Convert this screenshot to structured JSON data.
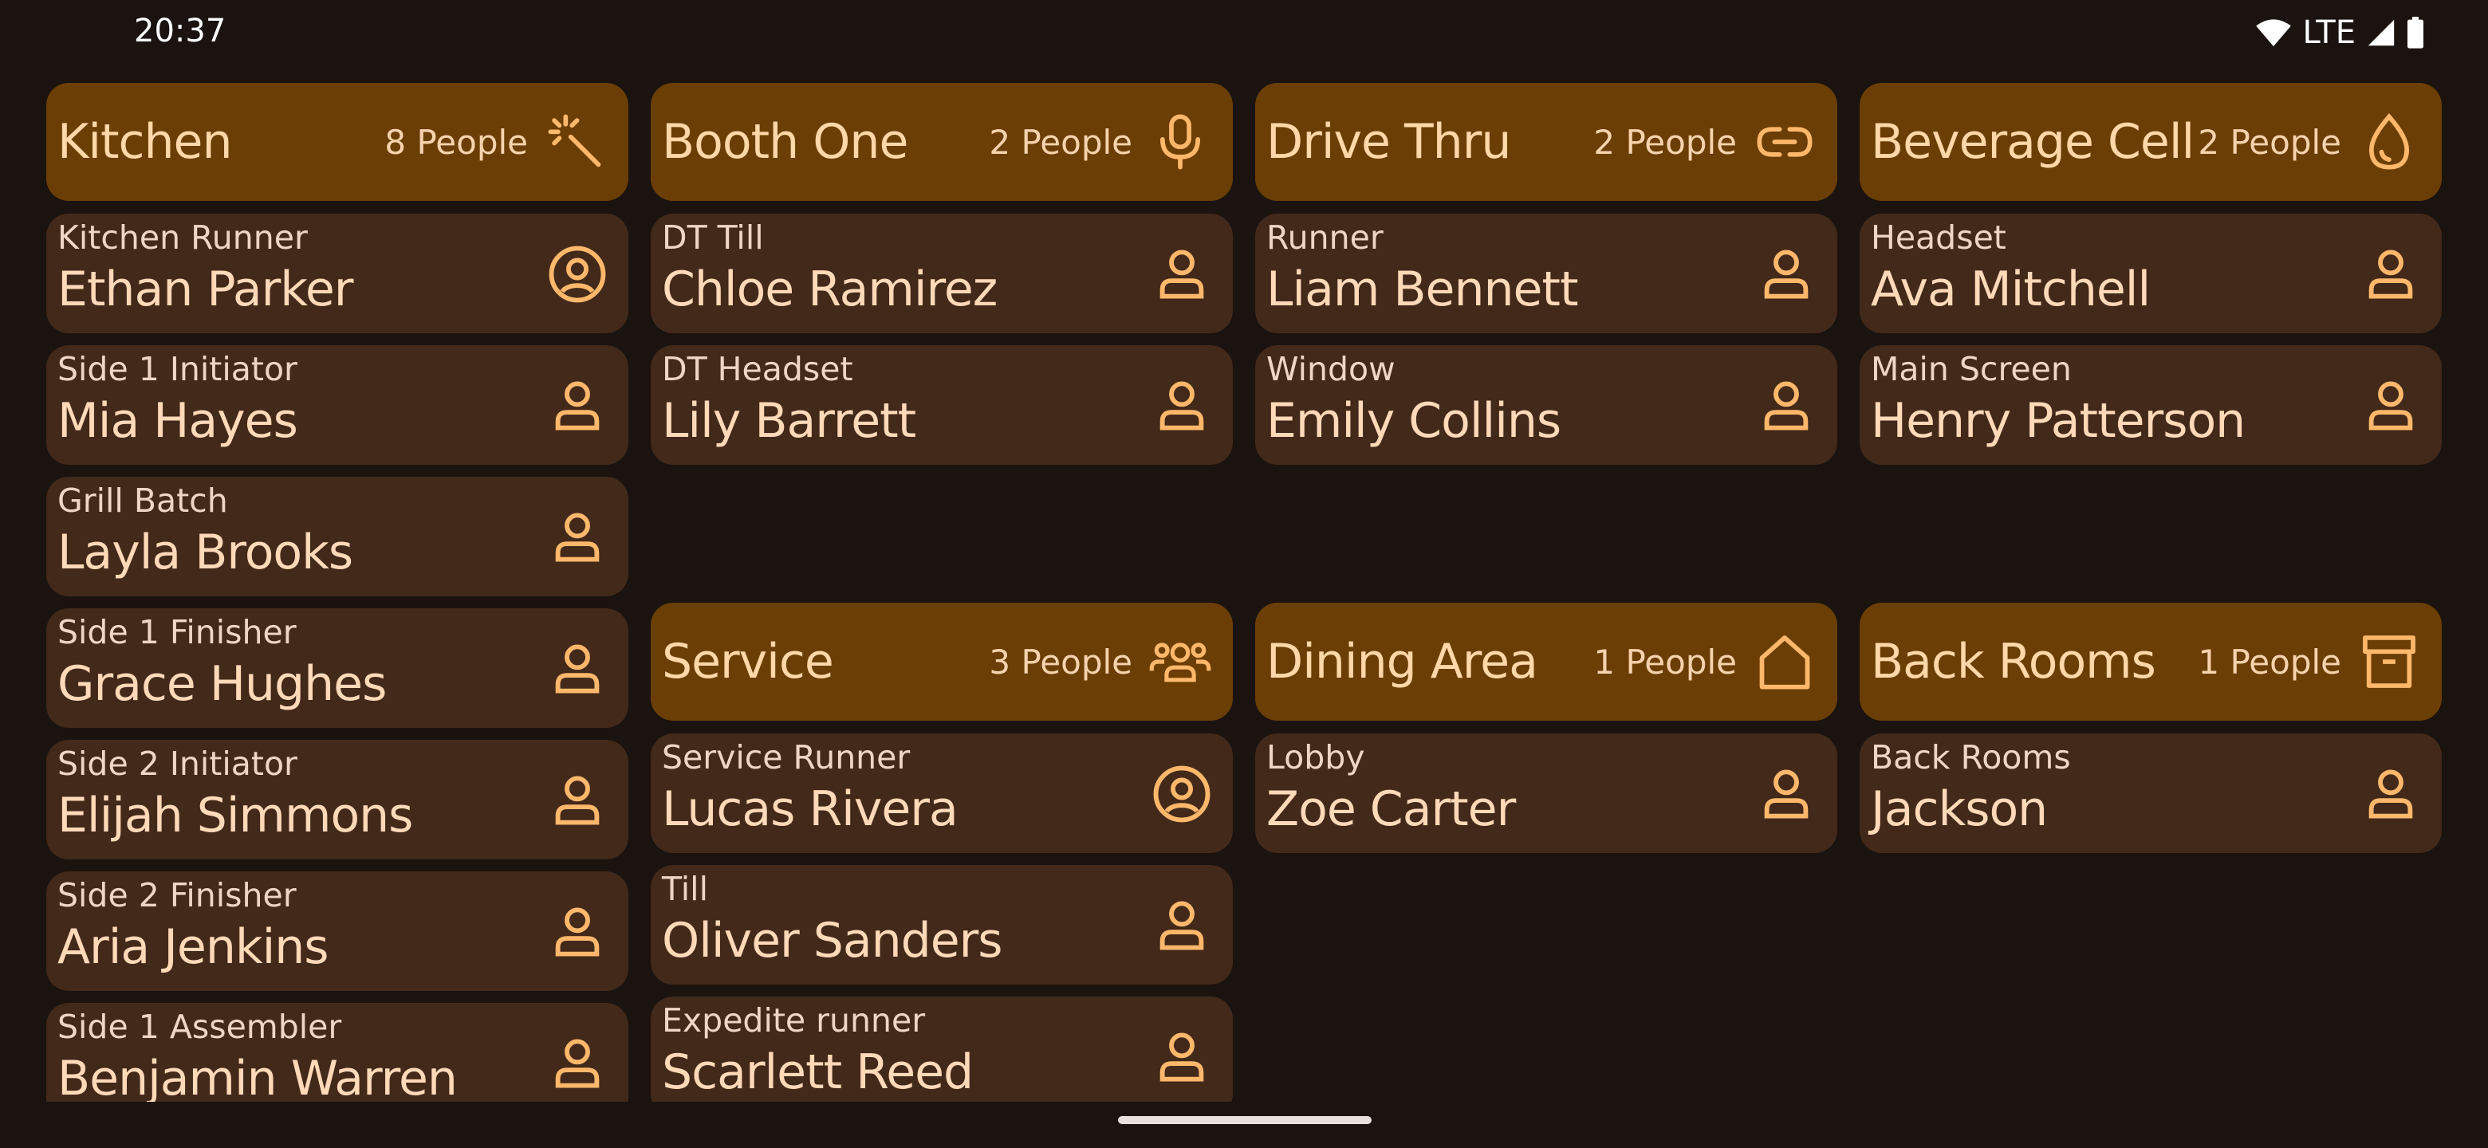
{
  "status": {
    "time": "20:37",
    "network": "LTE",
    "icons": [
      "wifi-icon",
      "signal-icon",
      "battery-icon"
    ]
  },
  "colors": {
    "background": "#1a1310",
    "header": "#6b3e05",
    "card": "#42291a",
    "accent": "#ffb86b"
  },
  "groups": [
    {
      "title": "Kitchen",
      "count": "8 People",
      "icon": "magic-wand-icon",
      "members": [
        {
          "role": "Kitchen Runner",
          "name": "Ethan Parker",
          "icon": "user-circle-icon"
        },
        {
          "role": "Side 1 Initiator",
          "name": "Mia Hayes",
          "icon": "user-icon"
        },
        {
          "role": "Grill Batch",
          "name": "Layla Brooks",
          "icon": "user-icon"
        },
        {
          "role": "Side 1 Finisher",
          "name": "Grace Hughes",
          "icon": "user-icon"
        },
        {
          "role": "Side 2 Initiator",
          "name": "Elijah Simmons",
          "icon": "user-icon"
        },
        {
          "role": "Side 2 Finisher",
          "name": "Aria Jenkins",
          "icon": "user-icon"
        },
        {
          "role": "Side 1 Assembler",
          "name": "Benjamin Warren",
          "icon": "user-icon"
        }
      ]
    },
    {
      "title": "Booth One",
      "count": "2 People",
      "icon": "microphone-icon",
      "members": [
        {
          "role": "DT Till",
          "name": "Chloe Ramirez",
          "icon": "user-icon"
        },
        {
          "role": "DT Headset",
          "name": "Lily Barrett",
          "icon": "user-icon"
        }
      ]
    },
    {
      "title": "Drive Thru",
      "count": "2 People",
      "icon": "link-icon",
      "members": [
        {
          "role": "Runner",
          "name": "Liam Bennett",
          "icon": "user-icon"
        },
        {
          "role": "Window",
          "name": "Emily Collins",
          "icon": "user-icon"
        }
      ]
    },
    {
      "title": "Beverage Cell",
      "count": "2 People",
      "icon": "droplet-icon",
      "members": [
        {
          "role": "Headset",
          "name": "Ava Mitchell",
          "icon": "user-icon"
        },
        {
          "role": "Main Screen",
          "name": "Henry Patterson",
          "icon": "user-icon"
        }
      ]
    },
    {
      "title": "Service",
      "count": "3 People",
      "icon": "users-group-icon",
      "members": [
        {
          "role": "Service Runner",
          "name": "Lucas Rivera",
          "icon": "user-circle-icon"
        },
        {
          "role": "Till",
          "name": "Oliver Sanders",
          "icon": "user-icon"
        },
        {
          "role": "Expedite runner",
          "name": "Scarlett Reed",
          "icon": "user-icon"
        }
      ]
    },
    {
      "title": "Dining Area",
      "count": "1 People",
      "icon": "home-icon",
      "members": [
        {
          "role": "Lobby",
          "name": "Zoe Carter",
          "icon": "user-icon"
        }
      ]
    },
    {
      "title": "Back Rooms",
      "count": "1 People",
      "icon": "archive-icon",
      "members": [
        {
          "role": "Back Rooms",
          "name": "Jackson",
          "icon": "user-icon"
        }
      ]
    }
  ]
}
